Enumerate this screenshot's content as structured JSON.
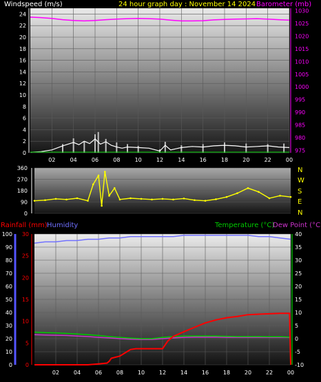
{
  "header": {
    "windspeed_label": "Windspeed (m/s)",
    "title": "24 hour graph day : November 14 2024",
    "barometer_label": "Barometer (mb)"
  },
  "compass": [
    "N",
    "W",
    "S",
    "E",
    "N"
  ],
  "lower_header": {
    "rainfall_label": "Rainfall (mm)",
    "humidity_label": "Humidity",
    "temperature_label": "Temperature (°C)",
    "dewpoint_label": "Dew Point (°C)"
  },
  "colors": {
    "windspeed": "#ffffff",
    "gust": "#c0c0c0",
    "barometer": "#ff00ff",
    "direction": "#ffff00",
    "rainfall": "#ff0000",
    "humidity": "#7070ff",
    "temperature": "#00cc00",
    "dewpoint": "#cc33cc",
    "label_yellow": "#ffff00",
    "axis_green": "#00ff00"
  },
  "chart_data": [
    {
      "type": "line",
      "name": "wind-baro",
      "x_ticks": [
        "02",
        "04",
        "06",
        "08",
        "10",
        "12",
        "14",
        "16",
        "18",
        "20",
        "22",
        "00"
      ],
      "left_axis": {
        "ylim": [
          0,
          25
        ],
        "ticks": [
          0,
          2,
          4,
          6,
          8,
          10,
          12,
          14,
          16,
          18,
          20,
          22,
          24
        ]
      },
      "right_axis": {
        "ylim": [
          974,
          1031
        ],
        "ticks": [
          975,
          980,
          985,
          990,
          995,
          1000,
          1005,
          1010,
          1015,
          1020,
          1025,
          1030
        ]
      },
      "series": [
        {
          "name": "Barometer (mb)",
          "axis": "right",
          "x": [
            0,
            1,
            2,
            3,
            4,
            5,
            6,
            7,
            8,
            9,
            10,
            11,
            12,
            13,
            14,
            15,
            16,
            17,
            18,
            19,
            20,
            21,
            22,
            23,
            24
          ],
          "values": [
            1027.5,
            1027.3,
            1027.0,
            1026.5,
            1026.2,
            1026.0,
            1026.2,
            1026.5,
            1026.7,
            1026.9,
            1027.0,
            1026.9,
            1026.7,
            1026.3,
            1026.0,
            1026.0,
            1026.1,
            1026.4,
            1026.6,
            1026.7,
            1026.8,
            1026.9,
            1026.7,
            1026.5,
            1026.3
          ]
        },
        {
          "name": "Windspeed (m/s)",
          "axis": "left",
          "x": [
            0,
            1,
            2,
            3,
            3.5,
            4,
            4.5,
            5,
            5.5,
            6,
            6.5,
            7,
            7.5,
            8,
            8.5,
            9,
            10,
            11,
            12,
            12.5,
            13,
            14,
            15,
            16,
            17,
            18,
            19,
            20,
            21,
            22,
            23,
            24
          ],
          "values": [
            0.1,
            0.2,
            0.5,
            1.2,
            1.5,
            1.8,
            1.4,
            2.0,
            1.6,
            2.4,
            1.5,
            1.9,
            1.3,
            1.0,
            0.8,
            1.0,
            0.9,
            0.8,
            0.3,
            1.3,
            0.5,
            0.9,
            1.1,
            1.0,
            1.2,
            1.3,
            1.2,
            1.0,
            1.1,
            1.2,
            1.0,
            0.9
          ]
        },
        {
          "name": "Gust",
          "axis": "left",
          "x": [
            3,
            4,
            5,
            6,
            6.3,
            7,
            8,
            9,
            10,
            12,
            12.5,
            14,
            16,
            18,
            20,
            22,
            23.5
          ],
          "values": [
            1.5,
            2.5,
            2.0,
            3.2,
            3.6,
            2.4,
            1.8,
            1.5,
            1.2,
            0.6,
            1.9,
            1.3,
            1.5,
            1.8,
            1.6,
            1.5,
            1.6
          ]
        }
      ]
    },
    {
      "type": "scatter",
      "name": "wind-direction",
      "ylim": [
        0,
        360
      ],
      "y_ticks": [
        0,
        90,
        180,
        270,
        360
      ],
      "x": [
        0,
        1,
        2,
        3,
        4,
        5,
        5.5,
        6,
        6.3,
        6.6,
        7,
        7.5,
        8,
        9,
        10,
        11,
        12,
        13,
        14,
        15,
        16,
        17,
        18,
        19,
        20,
        21,
        22,
        23,
        24
      ],
      "values": [
        100,
        105,
        115,
        110,
        120,
        100,
        230,
        300,
        60,
        330,
        140,
        200,
        110,
        120,
        115,
        110,
        115,
        110,
        118,
        105,
        100,
        112,
        130,
        160,
        200,
        170,
        120,
        140,
        130
      ]
    },
    {
      "type": "line",
      "name": "rain-temp",
      "x_ticks": [
        "02",
        "04",
        "06",
        "08",
        "10",
        "12",
        "14",
        "16",
        "18",
        "20",
        "22",
        "00"
      ],
      "rain_axis": {
        "ylim": [
          0,
          30
        ],
        "ticks": [
          0,
          5,
          10,
          15,
          20,
          25,
          30
        ]
      },
      "humidity_axis": {
        "ylim": [
          0,
          100
        ],
        "ticks": [
          0,
          10,
          20,
          30,
          40,
          50,
          60,
          70,
          80,
          90,
          100
        ]
      },
      "temperature_axis": {
        "ylim": [
          -10,
          40
        ],
        "ticks": [
          -10,
          -5,
          0,
          5,
          10,
          15,
          20,
          25,
          30,
          35,
          40
        ]
      },
      "series": [
        {
          "name": "Humidity",
          "x": [
            0,
            1,
            2,
            3,
            4,
            5,
            6,
            7,
            8,
            9,
            10,
            11,
            12,
            13,
            14,
            15,
            16,
            17,
            18,
            19,
            20,
            21,
            22,
            23,
            24
          ],
          "values": [
            93,
            94,
            94,
            95,
            95,
            96,
            96,
            97,
            97,
            98,
            98,
            98,
            98,
            98,
            99,
            99,
            99,
            99,
            99,
            99,
            99,
            98,
            98,
            97,
            96
          ]
        },
        {
          "name": "Temperature (°C)",
          "x": [
            0,
            1,
            2,
            3,
            4,
            5,
            6,
            7,
            8,
            9,
            10,
            11,
            12,
            13,
            14,
            15,
            16,
            17,
            18,
            19,
            20,
            21,
            22,
            23,
            24
          ],
          "values": [
            2.5,
            2.3,
            2.2,
            2.0,
            1.8,
            1.5,
            1.2,
            0.8,
            0.5,
            0.2,
            0.0,
            0.0,
            0.5,
            0.8,
            1.0,
            1.0,
            1.0,
            1.0,
            0.9,
            0.8,
            0.8,
            0.8,
            0.7,
            0.7,
            0.6
          ]
        },
        {
          "name": "Dew Point (°C)",
          "x": [
            0,
            1,
            2,
            3,
            4,
            5,
            6,
            7,
            8,
            9,
            10,
            11,
            12,
            13,
            14,
            15,
            16,
            17,
            18,
            19,
            20,
            21,
            22,
            23,
            24
          ],
          "values": [
            1.5,
            1.4,
            1.3,
            1.2,
            1.0,
            0.8,
            0.5,
            0.3,
            0.0,
            -0.2,
            -0.3,
            -0.3,
            0.0,
            0.3,
            0.5,
            0.6,
            0.6,
            0.6,
            0.5,
            0.5,
            0.5,
            0.5,
            0.5,
            0.5,
            0.5
          ]
        },
        {
          "name": "Rainfall (mm)",
          "x": [
            0,
            1,
            2,
            3,
            4,
            5,
            6,
            6.8,
            7,
            7.2,
            8,
            9,
            9.5,
            10,
            11,
            12,
            12.5,
            13,
            14,
            15,
            16,
            17,
            18,
            19,
            20,
            21,
            22,
            23,
            23.9,
            24
          ],
          "values": [
            0,
            0,
            0,
            0,
            0,
            0,
            0.2,
            0.4,
            0.8,
            1.5,
            2.0,
            3.5,
            3.7,
            3.7,
            3.7,
            3.7,
            5.5,
            6.5,
            7.6,
            8.6,
            9.6,
            10.3,
            10.8,
            11.1,
            11.5,
            11.6,
            11.7,
            11.8,
            11.8,
            0
          ]
        }
      ]
    }
  ]
}
